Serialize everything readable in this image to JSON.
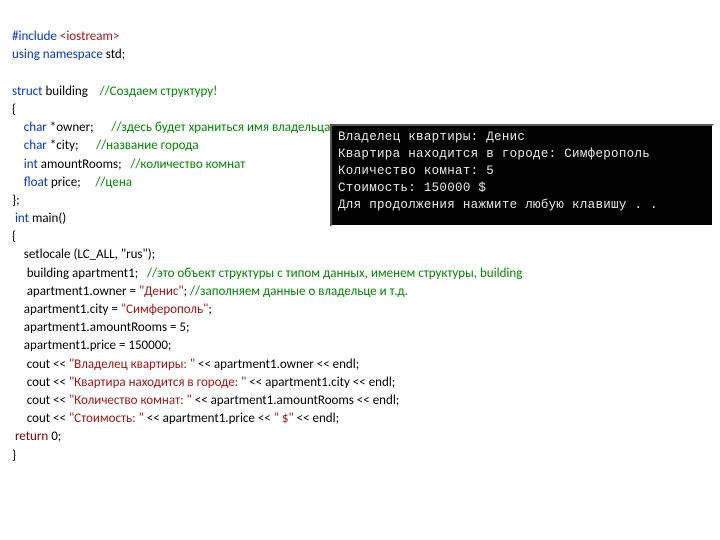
{
  "code": {
    "l1a": "#include ",
    "l1b": "<iostream>",
    "l2a": "using namespace",
    "l2b": " std;",
    "l3a": "struct",
    "l3b": " building    ",
    "l3c": "//Создаем структуру!",
    "l4": "{",
    "l5a": "    char ",
    "l5b": "*owner;      ",
    "l5c": "//здесь будет храниться имя владельца",
    "l6a": "    char ",
    "l6b": "*city;      ",
    "l6c": "//название города",
    "l7a": "    int ",
    "l7b": "amountRooms;   ",
    "l7c": "//количество комнат",
    "l8a": "    float ",
    "l8b": "price;     ",
    "l8c": "//цена",
    "l9": "};",
    "l10a": " int ",
    "l10b": "main()",
    "l11": "{",
    "l12": "    setlocale (LC_ALL, \"rus\");",
    "l13a": "     building apartment1;   ",
    "l13b": "//это объект структуры с типом данных, именем структуры, ",
    "l13c": "building",
    "l14a": "     apartment1.owner = ",
    "l14b": "\"Денис\"",
    "l14c": "; ",
    "l14d": "//заполняем данные о владельце и т.д.",
    "l15a": "    apartment1.city = ",
    "l15b": "\"Симферополь\"",
    "l15c": ";",
    "l16": "    apartment1.amountRooms = 5;",
    "l17": "    apartment1.price = 150000;",
    "l18a": "     cout << ",
    "l18b": "\"Владелец квартиры: \" ",
    "l18c": "<< apartment1.owner ",
    "l18d": "<< endl;",
    "l19a": "     cout ",
    "l19b": "<< ",
    "l19c": "\"Квартира находится в городе: \" ",
    "l19d": "<< apartment1.city << endl;",
    "l20a": "     cout ",
    "l20b": "<< ",
    "l20c": "\"Количество комнат: \" ",
    "l20d": "<< apartment1.amountRooms << endl;",
    "l21a": "     cout ",
    "l21b": "<< ",
    "l21c": "\"Стоимость: \" ",
    "l21d": "<< apartment1.price << ",
    "l21e": "\" $\" ",
    "l21f": "<< endl;",
    "l22a": " return ",
    "l22b": "0;",
    "l23": "}"
  },
  "console": {
    "line1": "Владелец квартиры: Денис",
    "line2": "Квартира находится в городе: Симферополь",
    "line3": "Количество комнат: 5",
    "line4": "Стоимость: 150000 $",
    "line5": "Для продолжения нажмите любую клавишу . ."
  }
}
